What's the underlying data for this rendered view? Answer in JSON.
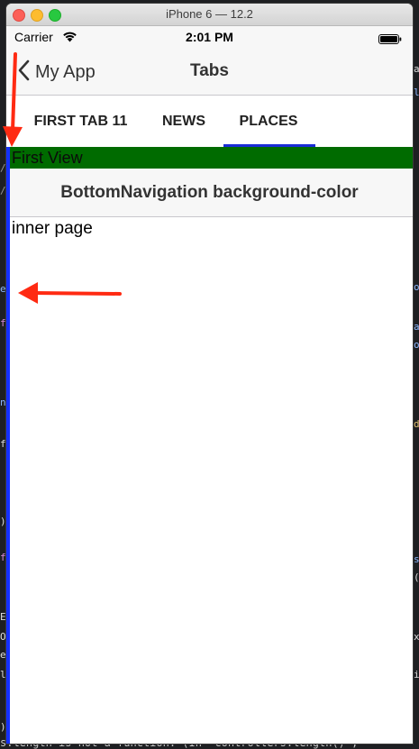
{
  "window": {
    "title": "iPhone 6 — 12.2"
  },
  "status_bar": {
    "carrier": "Carrier",
    "time": "2:01 PM",
    "wifi_icon": "wifi-icon",
    "battery_icon": "battery-icon"
  },
  "nav_bar": {
    "back_label": "My App",
    "title": "Tabs"
  },
  "tabs": [
    {
      "label": "FIRST TAB 11"
    },
    {
      "label": "NEWS"
    },
    {
      "label": "PLACES",
      "selected": true
    }
  ],
  "first_view": {
    "label": "First View",
    "background": "#006b00"
  },
  "sub_header": {
    "title": "BottomNavigation background-color"
  },
  "content": {
    "text": "inner page"
  },
  "background_editor": {
    "bottom_line": "s.length is not a function. (In 'controllers.length()', '"
  },
  "colors": {
    "tab_indicator": "#1a2bd6",
    "left_border": "#1430ff",
    "annotation_arrow": "#ff2a12"
  }
}
